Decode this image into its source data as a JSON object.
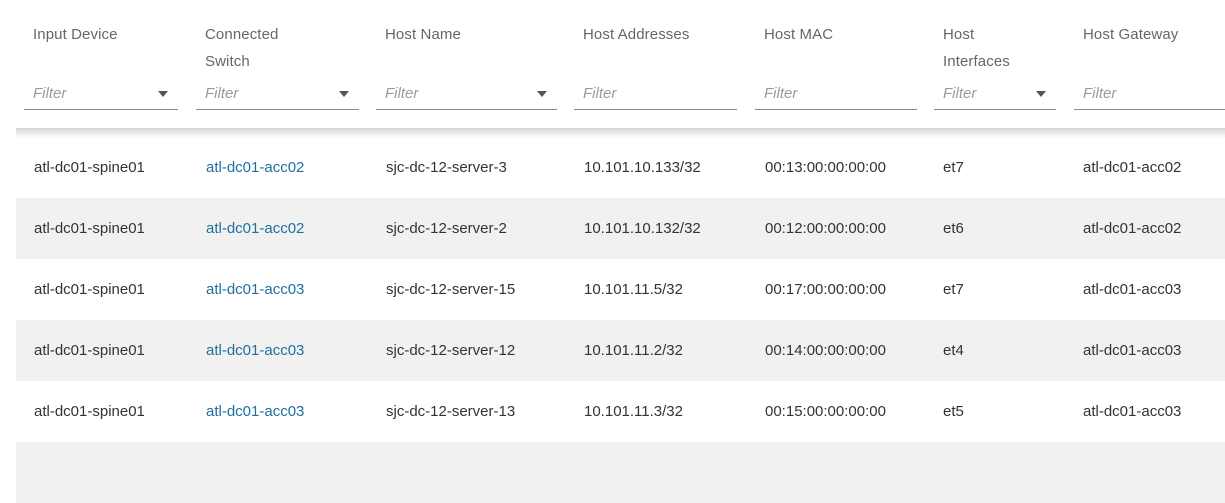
{
  "columns": [
    {
      "title_line1": "Input Device",
      "title_line2": "",
      "placeholder": "Filter",
      "dropdown": true
    },
    {
      "title_line1": "Connected",
      "title_line2": "Switch",
      "placeholder": "Filter",
      "dropdown": true
    },
    {
      "title_line1": "Host Name",
      "title_line2": "",
      "placeholder": "Filter",
      "dropdown": true
    },
    {
      "title_line1": "Host Addresses",
      "title_line2": "",
      "placeholder": "Filter",
      "dropdown": false
    },
    {
      "title_line1": "Host MAC",
      "title_line2": "",
      "placeholder": "Filter",
      "dropdown": false
    },
    {
      "title_line1": "Host",
      "title_line2": "Interfaces",
      "placeholder": "Filter",
      "dropdown": true
    },
    {
      "title_line1": "Host Gateway",
      "title_line2": "",
      "placeholder": "Filter",
      "dropdown": false
    }
  ],
  "rows": [
    {
      "input_device": "atl-dc01-spine01",
      "connected_switch": "atl-dc01-acc02",
      "host_name": "sjc-dc-12-server-3",
      "host_addresses": "10.101.10.133/32",
      "host_mac": "00:13:00:00:00:00",
      "host_interfaces": "et7",
      "host_gateway": "atl-dc01-acc02"
    },
    {
      "input_device": "atl-dc01-spine01",
      "connected_switch": "atl-dc01-acc02",
      "host_name": "sjc-dc-12-server-2",
      "host_addresses": "10.101.10.132/32",
      "host_mac": "00:12:00:00:00:00",
      "host_interfaces": "et6",
      "host_gateway": "atl-dc01-acc02"
    },
    {
      "input_device": "atl-dc01-spine01",
      "connected_switch": "atl-dc01-acc03",
      "host_name": "sjc-dc-12-server-15",
      "host_addresses": "10.101.11.5/32",
      "host_mac": "00:17:00:00:00:00",
      "host_interfaces": "et7",
      "host_gateway": "atl-dc01-acc03"
    },
    {
      "input_device": "atl-dc01-spine01",
      "connected_switch": "atl-dc01-acc03",
      "host_name": "sjc-dc-12-server-12",
      "host_addresses": "10.101.11.2/32",
      "host_mac": "00:14:00:00:00:00",
      "host_interfaces": "et4",
      "host_gateway": "atl-dc01-acc03"
    },
    {
      "input_device": "atl-dc01-spine01",
      "connected_switch": "atl-dc01-acc03",
      "host_name": "sjc-dc-12-server-13",
      "host_addresses": "10.101.11.3/32",
      "host_mac": "00:15:00:00:00:00",
      "host_interfaces": "et5",
      "host_gateway": "atl-dc01-acc03"
    },
    {
      "input_device": "",
      "connected_switch": "",
      "host_name": "",
      "host_addresses": "",
      "host_mac": "",
      "host_interfaces": "",
      "host_gateway": ""
    }
  ],
  "colors": {
    "link": "#1f6f9f",
    "row_alt": "#f1f1f1",
    "text": "#333333",
    "header_text": "#666666"
  },
  "icons": {
    "filter_dropdown": "caret-down-icon"
  }
}
